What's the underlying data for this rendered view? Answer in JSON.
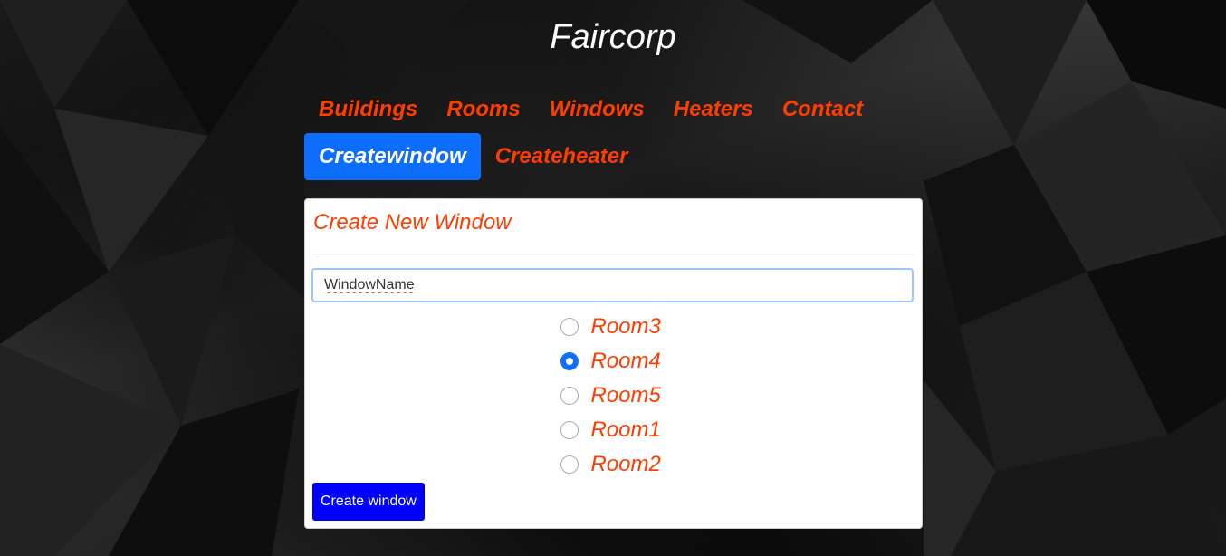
{
  "header": {
    "title": "Faircorp"
  },
  "nav": {
    "items": [
      {
        "label": "Buildings",
        "active": false
      },
      {
        "label": "Rooms",
        "active": false
      },
      {
        "label": "Windows",
        "active": false
      },
      {
        "label": "Heaters",
        "active": false
      },
      {
        "label": "Contact",
        "active": false
      },
      {
        "label": "Createwindow",
        "active": true
      },
      {
        "label": "Createheater",
        "active": false
      }
    ]
  },
  "form": {
    "title": "Create New Window",
    "name_input": {
      "value": "WindowName",
      "placeholder": ""
    },
    "rooms": [
      {
        "label": "Room3",
        "checked": false
      },
      {
        "label": "Room4",
        "checked": true
      },
      {
        "label": "Room5",
        "checked": false
      },
      {
        "label": "Room1",
        "checked": false
      },
      {
        "label": "Room2",
        "checked": false
      }
    ],
    "submit_label": "Create window"
  },
  "colors": {
    "accent": "#ff3d00",
    "active_tab": "#0d6efd",
    "submit_button": "#0000ff"
  }
}
